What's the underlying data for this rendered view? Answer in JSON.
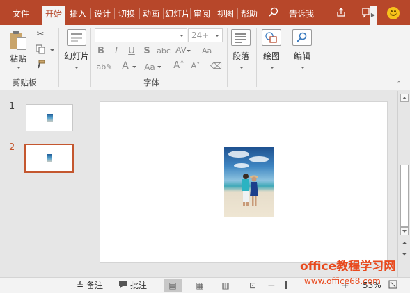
{
  "ribbon_tabs": {
    "file": "文件",
    "home": "开始",
    "insert": "插入",
    "design": "设计",
    "transitions": "切换",
    "animations": "动画",
    "slideshow": "幻灯片",
    "review": "审阅",
    "view": "视图",
    "help": "帮助",
    "tell_me": "告诉我"
  },
  "ribbon": {
    "paste": "粘贴",
    "clipboard": "剪贴板",
    "slides": "幻灯片",
    "font_group": "字体",
    "font_size": "24+",
    "paragraph": "段落",
    "drawing": "绘图",
    "editing": "编辑"
  },
  "thumbnails": {
    "slide1_number": "1",
    "slide2_number": "2",
    "selected_slide": 2
  },
  "statusbar": {
    "notes": "备注",
    "comments": "批注",
    "zoom_text": "53%"
  },
  "watermark": {
    "line1": "office教程学习网",
    "line2": "www.office68.com"
  },
  "colors": {
    "accent": "#b7472a",
    "selection": "#c4572f",
    "watermark": "#e8491d"
  }
}
